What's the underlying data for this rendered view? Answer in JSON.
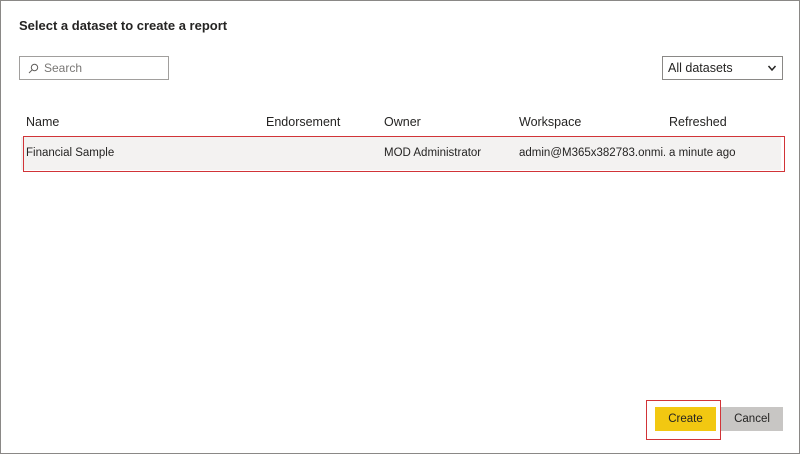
{
  "dialog": {
    "title": "Select a dataset to create a report"
  },
  "search": {
    "placeholder": "Search",
    "icon": "search-icon"
  },
  "filter": {
    "selected": "All datasets",
    "icon": "chevron-down-icon"
  },
  "table": {
    "columns": [
      "Name",
      "Endorsement",
      "Owner",
      "Workspace",
      "Refreshed"
    ],
    "rows": [
      {
        "name": "Financial Sample",
        "endorsement": "",
        "owner": "MOD Administrator",
        "workspace": "admin@M365x382783.onmi...",
        "refreshed": "a minute ago"
      }
    ]
  },
  "buttons": {
    "create": "Create",
    "cancel": "Cancel"
  },
  "colors": {
    "accent": "#F2C811",
    "highlight_outline": "#D13438",
    "row_selected": "#F3F2F1",
    "cancel_bg": "#C8C6C4"
  }
}
